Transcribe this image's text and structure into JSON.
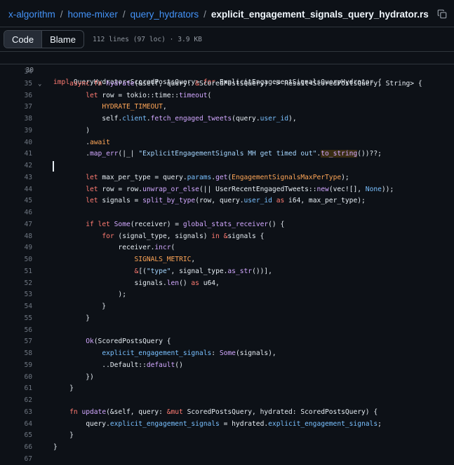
{
  "breadcrumb": {
    "repo": "x-algorithm",
    "sep": "/",
    "dir1": "home-mixer",
    "dir2": "query_hydrators",
    "file": "explicit_engagement_signals_query_hydrator.rs"
  },
  "toolbar": {
    "code_label": "Code",
    "blame_label": "Blame",
    "file_info": "112 lines (97 loc) · 3.9 KB"
  },
  "sticky": {
    "line_number": "30",
    "tokens": [
      {
        "t": "impl ",
        "c": "k"
      },
      {
        "t": "QueryHydrator<ScoredPostsQuery> ",
        "c": "pl"
      },
      {
        "t": "for ",
        "c": "k"
      },
      {
        "t": "ExplicitEngagementSignalsQueryHydrator {",
        "c": "pl"
      }
    ]
  },
  "code": [
    {
      "n": "34",
      "tokens": []
    },
    {
      "n": "35",
      "fold": "⌄",
      "tokens": [
        {
          "t": "    ",
          "c": "pl"
        },
        {
          "t": "async fn ",
          "c": "k"
        },
        {
          "t": "hydrate",
          "c": "f"
        },
        {
          "t": "(&self, query: ",
          "c": "pl"
        },
        {
          "t": "&",
          "c": "k"
        },
        {
          "t": "ScoredPostsQuery) -> Result<ScoredPostsQuery, String> {",
          "c": "pl"
        }
      ]
    },
    {
      "n": "36",
      "tokens": [
        {
          "t": "        ",
          "c": "pl"
        },
        {
          "t": "let ",
          "c": "k"
        },
        {
          "t": "row = tokio::time::",
          "c": "pl"
        },
        {
          "t": "timeout",
          "c": "f"
        },
        {
          "t": "(",
          "c": "pl"
        }
      ]
    },
    {
      "n": "37",
      "tokens": [
        {
          "t": "            ",
          "c": "pl"
        },
        {
          "t": "HYDRATE_TIMEOUT",
          "c": "v"
        },
        {
          "t": ",",
          "c": "pl"
        }
      ]
    },
    {
      "n": "38",
      "tokens": [
        {
          "t": "            self.",
          "c": "pl"
        },
        {
          "t": "client",
          "c": "c"
        },
        {
          "t": ".",
          "c": "pl"
        },
        {
          "t": "fetch_engaged_tweets",
          "c": "f"
        },
        {
          "t": "(query.",
          "c": "pl"
        },
        {
          "t": "user_id",
          "c": "c"
        },
        {
          "t": "),",
          "c": "pl"
        }
      ]
    },
    {
      "n": "39",
      "tokens": [
        {
          "t": "        )",
          "c": "pl"
        }
      ]
    },
    {
      "n": "40",
      "tokens": [
        {
          "t": "        .",
          "c": "pl"
        },
        {
          "t": "await",
          "c": "v"
        }
      ]
    },
    {
      "n": "41",
      "tokens": [
        {
          "t": "        .",
          "c": "pl"
        },
        {
          "t": "map_err",
          "c": "f"
        },
        {
          "t": "(|_| ",
          "c": "pl"
        },
        {
          "t": "\"ExplicitEngagementSignals MH get timed out\"",
          "c": "s"
        },
        {
          "t": ".",
          "c": "pl"
        },
        {
          "t": "to_string",
          "c": "f",
          "hl": true
        },
        {
          "t": "())??;",
          "c": "pl"
        }
      ]
    },
    {
      "n": "42",
      "cursor": true,
      "tokens": []
    },
    {
      "n": "43",
      "tokens": [
        {
          "t": "        ",
          "c": "pl"
        },
        {
          "t": "let ",
          "c": "k"
        },
        {
          "t": "max_per_type = query.",
          "c": "pl"
        },
        {
          "t": "params",
          "c": "c"
        },
        {
          "t": ".",
          "c": "pl"
        },
        {
          "t": "get",
          "c": "f"
        },
        {
          "t": "(",
          "c": "pl"
        },
        {
          "t": "EngagementSignalsMaxPerType",
          "c": "v"
        },
        {
          "t": ");",
          "c": "pl"
        }
      ]
    },
    {
      "n": "44",
      "tokens": [
        {
          "t": "        ",
          "c": "pl"
        },
        {
          "t": "let ",
          "c": "k"
        },
        {
          "t": "row = row.",
          "c": "pl"
        },
        {
          "t": "unwrap_or_else",
          "c": "f"
        },
        {
          "t": "(|| UserRecentEngagedTweets::",
          "c": "pl"
        },
        {
          "t": "new",
          "c": "f"
        },
        {
          "t": "(vec![], ",
          "c": "pl"
        },
        {
          "t": "None",
          "c": "c"
        },
        {
          "t": "));",
          "c": "pl"
        }
      ]
    },
    {
      "n": "45",
      "tokens": [
        {
          "t": "        ",
          "c": "pl"
        },
        {
          "t": "let ",
          "c": "k"
        },
        {
          "t": "signals = ",
          "c": "pl"
        },
        {
          "t": "split_by_type",
          "c": "f"
        },
        {
          "t": "(row, query.",
          "c": "pl"
        },
        {
          "t": "user_id",
          "c": "c"
        },
        {
          "t": " ",
          "c": "pl"
        },
        {
          "t": "as ",
          "c": "k"
        },
        {
          "t": "i64, max_per_type);",
          "c": "pl"
        }
      ]
    },
    {
      "n": "46",
      "tokens": []
    },
    {
      "n": "47",
      "tokens": [
        {
          "t": "        ",
          "c": "pl"
        },
        {
          "t": "if let ",
          "c": "k"
        },
        {
          "t": "Some",
          "c": "f"
        },
        {
          "t": "(receiver) = ",
          "c": "pl"
        },
        {
          "t": "global_stats_receiver",
          "c": "f"
        },
        {
          "t": "() {",
          "c": "pl"
        }
      ]
    },
    {
      "n": "48",
      "tokens": [
        {
          "t": "            ",
          "c": "pl"
        },
        {
          "t": "for ",
          "c": "k"
        },
        {
          "t": "(signal_type, signals) ",
          "c": "pl"
        },
        {
          "t": "in ",
          "c": "k"
        },
        {
          "t": "&",
          "c": "k"
        },
        {
          "t": "signals {",
          "c": "pl"
        }
      ]
    },
    {
      "n": "49",
      "tokens": [
        {
          "t": "                receiver.",
          "c": "pl"
        },
        {
          "t": "incr",
          "c": "f"
        },
        {
          "t": "(",
          "c": "pl"
        }
      ]
    },
    {
      "n": "50",
      "tokens": [
        {
          "t": "                    ",
          "c": "pl"
        },
        {
          "t": "SIGNALS_METRIC",
          "c": "v"
        },
        {
          "t": ",",
          "c": "pl"
        }
      ]
    },
    {
      "n": "51",
      "tokens": [
        {
          "t": "                    ",
          "c": "pl"
        },
        {
          "t": "&",
          "c": "k"
        },
        {
          "t": "[(",
          "c": "pl"
        },
        {
          "t": "\"type\"",
          "c": "s"
        },
        {
          "t": ", signal_type.",
          "c": "pl"
        },
        {
          "t": "as_str",
          "c": "f"
        },
        {
          "t": "())],",
          "c": "pl"
        }
      ]
    },
    {
      "n": "52",
      "tokens": [
        {
          "t": "                    signals.",
          "c": "pl"
        },
        {
          "t": "len",
          "c": "f"
        },
        {
          "t": "() ",
          "c": "pl"
        },
        {
          "t": "as ",
          "c": "k"
        },
        {
          "t": "u64,",
          "c": "pl"
        }
      ]
    },
    {
      "n": "53",
      "tokens": [
        {
          "t": "                );",
          "c": "pl"
        }
      ]
    },
    {
      "n": "54",
      "tokens": [
        {
          "t": "            }",
          "c": "pl"
        }
      ]
    },
    {
      "n": "55",
      "tokens": [
        {
          "t": "        }",
          "c": "pl"
        }
      ]
    },
    {
      "n": "56",
      "tokens": []
    },
    {
      "n": "57",
      "tokens": [
        {
          "t": "        ",
          "c": "pl"
        },
        {
          "t": "Ok",
          "c": "f"
        },
        {
          "t": "(ScoredPostsQuery {",
          "c": "pl"
        }
      ]
    },
    {
      "n": "58",
      "tokens": [
        {
          "t": "            ",
          "c": "pl"
        },
        {
          "t": "explicit_engagement_signals",
          "c": "c"
        },
        {
          "t": ": ",
          "c": "pl"
        },
        {
          "t": "Some",
          "c": "f"
        },
        {
          "t": "(signals),",
          "c": "pl"
        }
      ]
    },
    {
      "n": "59",
      "tokens": [
        {
          "t": "            ..Default::",
          "c": "pl"
        },
        {
          "t": "default",
          "c": "f"
        },
        {
          "t": "()",
          "c": "pl"
        }
      ]
    },
    {
      "n": "60",
      "tokens": [
        {
          "t": "        })",
          "c": "pl"
        }
      ]
    },
    {
      "n": "61",
      "tokens": [
        {
          "t": "    }",
          "c": "pl"
        }
      ]
    },
    {
      "n": "62",
      "tokens": []
    },
    {
      "n": "63",
      "tokens": [
        {
          "t": "    ",
          "c": "pl"
        },
        {
          "t": "fn ",
          "c": "k"
        },
        {
          "t": "update",
          "c": "f"
        },
        {
          "t": "(&self, query: ",
          "c": "pl"
        },
        {
          "t": "&mut ",
          "c": "k"
        },
        {
          "t": "ScoredPostsQuery, hydrated: ScoredPostsQuery) {",
          "c": "pl"
        }
      ]
    },
    {
      "n": "64",
      "tokens": [
        {
          "t": "        query.",
          "c": "pl"
        },
        {
          "t": "explicit_engagement_signals",
          "c": "c"
        },
        {
          "t": " = hydrated.",
          "c": "pl"
        },
        {
          "t": "explicit_engagement_signals",
          "c": "c"
        },
        {
          "t": ";",
          "c": "pl"
        }
      ]
    },
    {
      "n": "65",
      "tokens": [
        {
          "t": "    }",
          "c": "pl"
        }
      ]
    },
    {
      "n": "66",
      "tokens": [
        {
          "t": "}",
          "c": "pl"
        }
      ]
    },
    {
      "n": "67",
      "tokens": []
    }
  ]
}
